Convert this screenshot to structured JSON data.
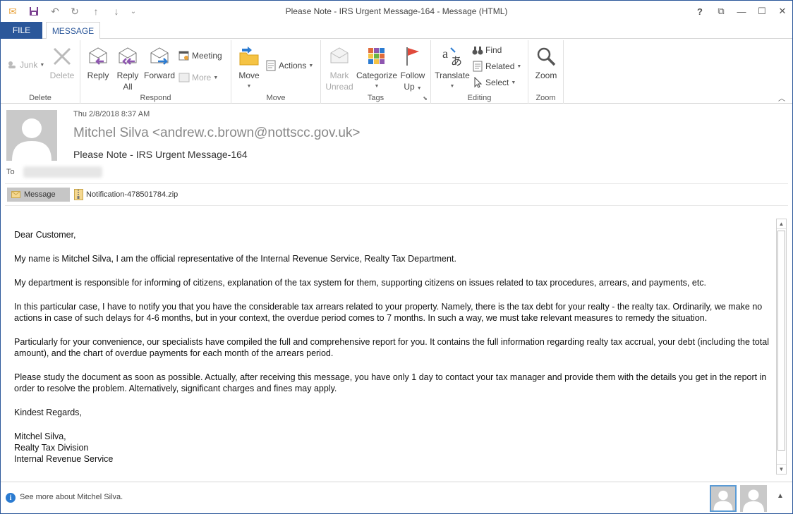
{
  "window": {
    "title": "Please Note - IRS Urgent Message-164 - Message (HTML)",
    "controls": {
      "help": "?",
      "restore_ribbon": "⧉",
      "minimize": "—",
      "maximize": "☐",
      "close": "✕"
    }
  },
  "quick_access": {
    "mail": "✉",
    "save": "💾",
    "undo": "↶",
    "redo": "↻",
    "up": "↑",
    "down": "↓",
    "customize": "⌄"
  },
  "tabs": {
    "file": "FILE",
    "message": "MESSAGE"
  },
  "ribbon": {
    "delete_group": {
      "label": "Delete",
      "junk": "Junk",
      "delete": "Delete"
    },
    "respond_group": {
      "label": "Respond",
      "reply": "Reply",
      "reply_all_1": "Reply",
      "reply_all_2": "All",
      "forward": "Forward",
      "meeting": "Meeting",
      "more": "More"
    },
    "move_group": {
      "label": "Move",
      "move": "Move",
      "actions": "Actions"
    },
    "tags_group": {
      "label": "Tags",
      "mark_unread_1": "Mark",
      "mark_unread_2": "Unread",
      "categorize": "Categorize",
      "follow_up_1": "Follow",
      "follow_up_2": "Up"
    },
    "editing_group": {
      "label": "Editing",
      "translate": "Translate",
      "find": "Find",
      "related": "Related",
      "select": "Select"
    },
    "zoom_group": {
      "label": "Zoom",
      "zoom": "Zoom"
    }
  },
  "header": {
    "date": "Thu 2/8/2018 8:37 AM",
    "from": "Mitchel Silva <andrew.c.brown@nottscc.gov.uk>",
    "subject": "Please Note - IRS Urgent Message-164",
    "to_label": "To",
    "message_tab": "Message",
    "attachment": "Notification-478501784.zip"
  },
  "body": {
    "paragraphs": [
      "Dear Customer,",
      "My name is Mitchel Silva, I am the official representative of the Internal Revenue Service, Realty Tax Department.",
      "My department is responsible for informing of citizens, explanation of the tax system for them, supporting citizens on issues related to tax procedures, arrears, and payments, etc.",
      "In this particular case, I have to notify you that you have the considerable tax arrears related to your property. Namely, there is the tax debt for your realty - the realty tax. Ordinarily, we make no actions in case of such delays for 4-6 months, but in your context, the overdue period comes to 7 months. In such a way, we must take relevant measures to remedy the situation.",
      "Particularly for your convenience, our specialists have compiled the full and comprehensive report for you. It contains the full information regarding realty tax accrual, your debt (including the total amount), and the chart of overdue payments for each month of the arrears period.",
      "Please study the document as soon as possible. Actually, after receiving this message, you have only 1 day to contact your tax manager and provide them with the details you get in the report in order to resolve the problem. Alternatively, significant charges and fines may apply.",
      "Kindest Regards,"
    ],
    "signature": [
      "Mitchel Silva,",
      "Realty Tax Division",
      "Internal Revenue Service"
    ]
  },
  "people_pane": {
    "see_more": "See more about Mitchel Silva.",
    "info_icon": "i",
    "collapse": "▲"
  },
  "colors": {
    "accent": "#2b579a",
    "file_tab_text": "#ffffff"
  }
}
